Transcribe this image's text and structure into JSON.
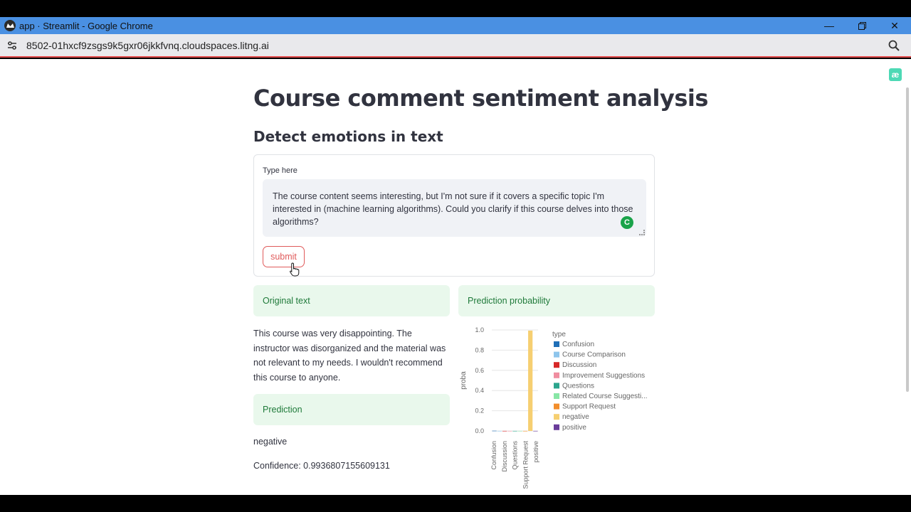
{
  "browser": {
    "window_title": "app · Streamlit - Google Chrome",
    "url": "8502-01hxcf9zsgs9k5gxr06jkkfvnq.cloudspaces.litng.ai"
  },
  "app": {
    "title": "Course comment sentiment analysis",
    "subtitle": "Detect emotions in text",
    "input_label": "Type here",
    "input_value": "The course content seems interesting, but I'm not sure if it covers a specific topic I'm interested in (machine learning algorithms). Could you clarify if this course delves into those algorithms?",
    "submit_label": "submit",
    "original_text_header": "Original text",
    "original_text": "This course was very disappointing. The instructor was disorganized and the material was not relevant to my needs. I wouldn't recommend this course to anyone.",
    "prediction_header": "Prediction",
    "prediction_value": "negative",
    "confidence_text": "Confidence: 0.9936807155609131",
    "probability_header": "Prediction probability"
  },
  "chart_data": {
    "type": "bar",
    "ylabel": "proba",
    "ylim": [
      0,
      1.0
    ],
    "yticks": [
      "0.0",
      "0.2",
      "0.4",
      "0.6",
      "0.8",
      "1.0"
    ],
    "x_tick_labels": [
      "Confusion",
      "Discussion",
      "Questions",
      "Support Request",
      "positive"
    ],
    "legend_title": "type",
    "categories": [
      "Confusion",
      "Course Comparison",
      "Discussion",
      "Improvement Suggestions",
      "Questions",
      "Related Course Suggesti...",
      "Support Request",
      "negative",
      "positive"
    ],
    "values": [
      0.002,
      0.0005,
      0.0005,
      0.0005,
      0.0005,
      0.0005,
      0.0005,
      0.9937,
      0.0005
    ],
    "colors": [
      "#1f6fb7",
      "#8ec5ec",
      "#d62728",
      "#f08ea0",
      "#2ca58d",
      "#88e6a6",
      "#f28e2b",
      "#f6cf71",
      "#6a3d9a"
    ]
  }
}
